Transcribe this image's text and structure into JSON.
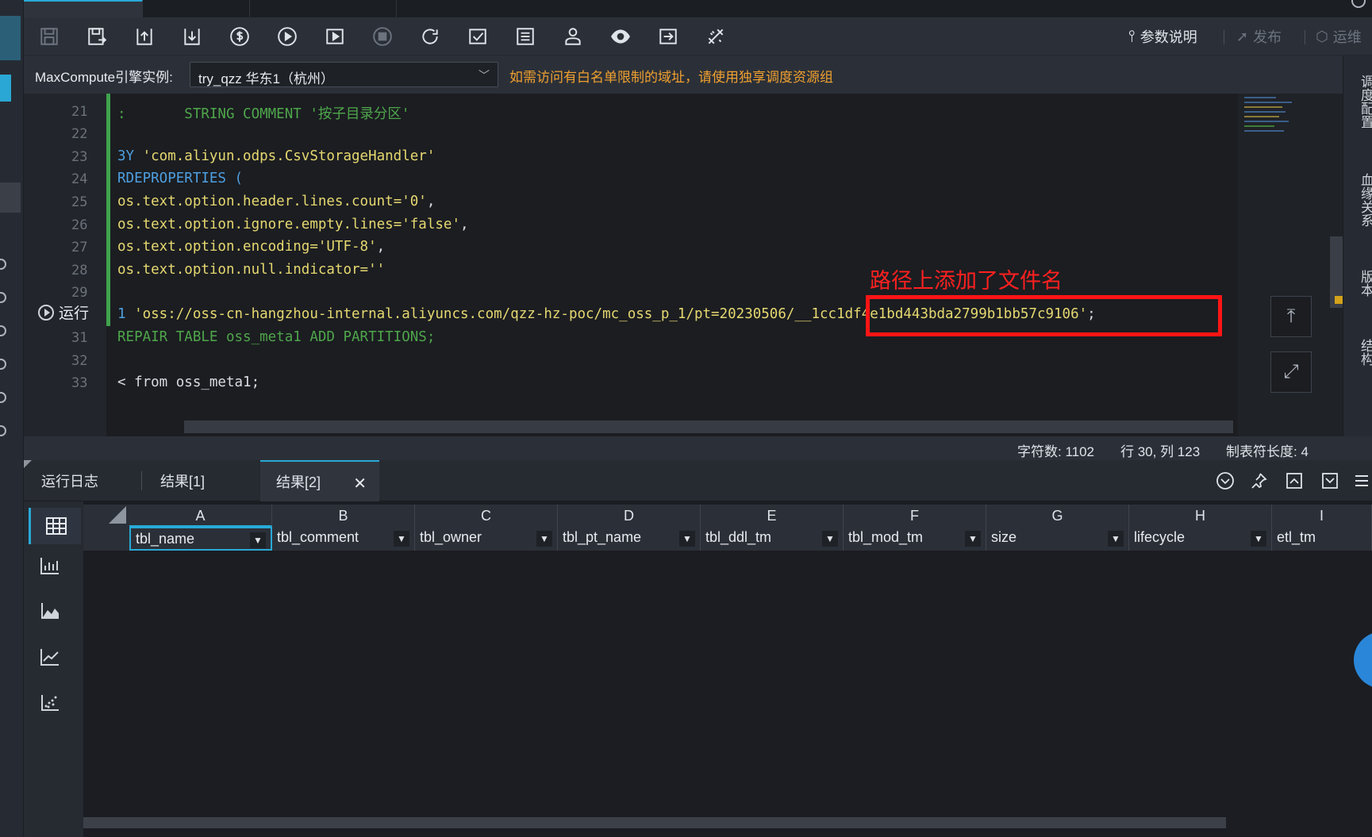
{
  "toolbar": {
    "buttons": [
      "save-icon",
      "save-as-icon",
      "upload-icon",
      "import-icon",
      "cost-icon",
      "run-icon",
      "run-with-params-icon",
      "stop-icon",
      "refresh-icon",
      "check-icon",
      "format-icon",
      "user-icon",
      "preview-icon",
      "export-icon",
      "tools-icon"
    ],
    "params_label": "参数说明",
    "publish_label": "发布",
    "ops_label": "运维"
  },
  "engine": {
    "label": "MaxCompute引擎实例:",
    "selected": "try_qzz 华东1（杭州）",
    "warning": "如需访问有白名单限制的域址，请使用独享调度资源组"
  },
  "right_panel": [
    "调度配置",
    "血缘关系",
    "版本",
    "结构"
  ],
  "editor": {
    "run_label": "运行",
    "line_numbers": [
      "21",
      "22",
      "23",
      "24",
      "25",
      "26",
      "27",
      "28",
      "29",
      "31",
      "32",
      "33"
    ],
    "lines": [
      {
        "pre": ":       STRING COMMENT ",
        "str": "'按子目录分区'",
        "post": "",
        "style": "cmt"
      },
      {
        "pre": "",
        "str": "",
        "post": ""
      },
      {
        "pre": "3Y ",
        "str": "'com.aliyun.odps.CsvStorageHandler'",
        "post": ""
      },
      {
        "pre": "RDEPROPERTIES (",
        "str": "",
        "post": ""
      },
      {
        "pre": "os.text.option.header.lines.count",
        "str": "='0'",
        "post": ","
      },
      {
        "pre": "os.text.option.ignore.empty.lines",
        "str": "='false'",
        "post": ","
      },
      {
        "pre": "os.text.option.encoding",
        "str": "='UTF-8'",
        "post": ","
      },
      {
        "pre": "os.text.option.null.indicator",
        "str": "=''",
        "post": ""
      },
      {
        "pre": "",
        "str": "",
        "post": ""
      },
      {
        "pre": "1 ",
        "str": "'oss://oss-cn-hangzhou-internal.aliyuncs.com/qzz-hz-poc/mc_oss_p_1/pt=20230506/__1cc1df4e1bd443bda2799b1bb57c9106'",
        "post": ";"
      },
      {
        "pre": "REPAIR TABLE oss_meta1 ADD PARTITIONS;",
        "str": "",
        "post": "",
        "style": "cmt"
      },
      {
        "pre": "",
        "str": "",
        "post": ""
      },
      {
        "pre": "< from oss_meta1;",
        "str": "",
        "post": ""
      }
    ],
    "annotation": "路径上添加了文件名"
  },
  "status": {
    "chars": "字符数: 1102",
    "position": "行 30, 列 123",
    "tab_width": "制表符长度: 4"
  },
  "result_tabs": [
    "运行日志",
    "结果[1]",
    "结果[2]"
  ],
  "result_actions": [
    "collapse-icon",
    "pin-icon",
    "maximize-icon",
    "download-icon",
    "menu-icon"
  ],
  "grid": {
    "columns": [
      "A",
      "B",
      "C",
      "D",
      "E",
      "F",
      "G",
      "H",
      "I"
    ],
    "fields": [
      "tbl_name",
      "tbl_comment",
      "tbl_owner",
      "tbl_pt_name",
      "tbl_ddl_tm",
      "tbl_mod_tm",
      "size",
      "lifecycle",
      "etl_tm"
    ]
  },
  "colors": {
    "accent": "#28a9d7",
    "warning": "#f0a030",
    "annotation": "#ff2020",
    "string": "#e6d870",
    "keyword": "#4e9fe0",
    "comment": "#4fa64b"
  }
}
